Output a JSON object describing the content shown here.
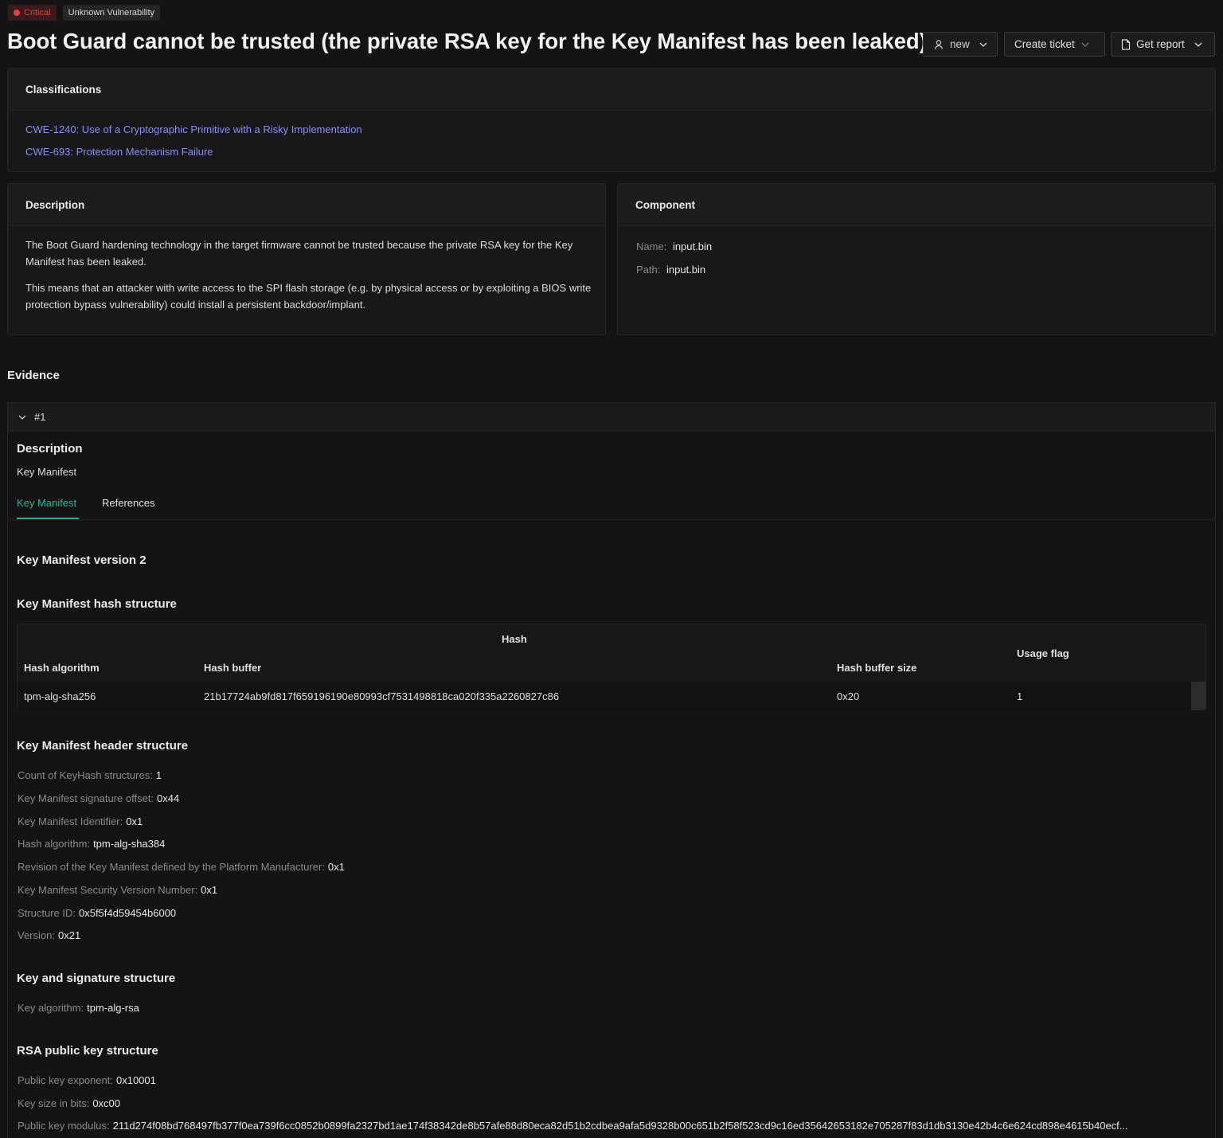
{
  "badges": {
    "severity": "Critical",
    "type": "Unknown Vulnerability"
  },
  "title": "Boot Guard cannot be trusted (the private RSA key for the Key Manifest has been leaked)",
  "actions": {
    "status_label": "new",
    "ticket_label": "Create ticket",
    "report_label": "Get report"
  },
  "classifications": {
    "heading": "Classifications",
    "items": [
      "CWE-1240: Use of a Cryptographic Primitive with a Risky Implementation",
      "CWE-693: Protection Mechanism Failure"
    ]
  },
  "description": {
    "heading": "Description",
    "paragraphs": [
      "The Boot Guard hardening technology in the target firmware cannot be trusted because the private RSA key for the Key Manifest has been leaked.",
      "This means that an attacker with write access to the SPI flash storage (e.g. by physical access or by exploiting a BIOS write protection bypass vulnerability) could install a persistent backdoor/implant."
    ]
  },
  "component": {
    "heading": "Component",
    "fields": [
      {
        "key": "Name",
        "value": "input.bin"
      },
      {
        "key": "Path",
        "value": "input.bin"
      }
    ]
  },
  "evidence": {
    "heading": "Evidence",
    "item_label": "#1",
    "description_heading": "Description",
    "description_value": "Key Manifest",
    "tabs": [
      "Key Manifest",
      "References"
    ],
    "version_title": "Key Manifest version 2",
    "hash_section_title": "Key Manifest hash structure",
    "hash_table": {
      "group_header": "Hash",
      "columns": [
        "Hash algorithm",
        "Hash buffer",
        "Hash buffer size",
        "Usage flag"
      ],
      "rows": [
        [
          "tpm-alg-sha256",
          "21b17724ab9fd817f659196190e80993cf7531498818ca020f335a2260827c86",
          "0x20",
          "1"
        ]
      ]
    },
    "header_section_title": "Key Manifest header structure",
    "header_fields": [
      {
        "key": "Count of KeyHash structures",
        "value": "1"
      },
      {
        "key": "Key Manifest signature offset",
        "value": "0x44"
      },
      {
        "key": "Key Manifest Identifier",
        "value": "0x1"
      },
      {
        "key": "Hash algorithm",
        "value": "tpm-alg-sha384"
      },
      {
        "key": "Revision of the Key Manifest defined by the Platform Manufacturer",
        "value": "0x1"
      },
      {
        "key": "Key Manifest Security Version Number",
        "value": "0x1"
      },
      {
        "key": "Structure ID",
        "value": "0x5f5f4d59454b6000"
      },
      {
        "key": "Version",
        "value": "0x21"
      }
    ],
    "signature_section_title": "Key and signature structure",
    "signature_fields": [
      {
        "key": "Key algorithm",
        "value": "tpm-alg-rsa"
      }
    ],
    "rsa_section_title": "RSA public key structure",
    "rsa_fields": [
      {
        "key": "Public key exponent",
        "value": "0x10001"
      },
      {
        "key": "Key size in bits",
        "value": "0xc00"
      },
      {
        "key": "Public key modulus",
        "value": "211d274f08bd768497fb377f0ea739f6cc0852b0899fa2327bd1ae174f38342de8b57afe88d80eca82d51b2cdbea9afa5d9328b00c651b2f58f523cd9c16ed35642653182e705287f83d1db3130e42b4c6e624cd898e4615b40ecf..."
      }
    ]
  }
}
